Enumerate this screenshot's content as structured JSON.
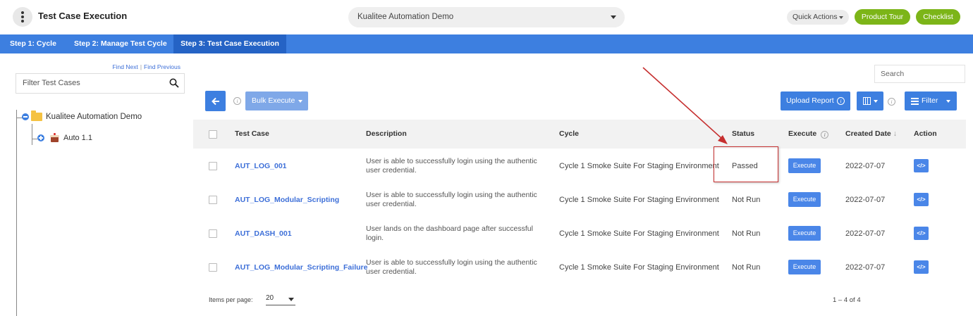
{
  "header": {
    "title": "Test Case Execution",
    "project": "Kualitee Automation Demo",
    "quick_actions": "Quick Actions",
    "product_tour": "Product Tour",
    "checklist": "Checklist"
  },
  "steps": [
    {
      "label": "Step 1: Cycle",
      "active": false
    },
    {
      "label": "Step 2: Manage Test Cycle",
      "active": false
    },
    {
      "label": "Step 3: Test Case Execution",
      "active": true
    }
  ],
  "left_panel": {
    "find_next": "Find Next",
    "separator": "|",
    "find_previous": "Find Previous",
    "filter_placeholder": "Filter Test Cases",
    "tree": {
      "root": "Kualitee Automation Demo",
      "child": "Auto 1.1"
    }
  },
  "toolbar": {
    "search_placeholder": "Search",
    "bulk_execute": "Bulk Execute",
    "upload_report": "Upload Report",
    "filter": "Filter"
  },
  "table": {
    "headers": {
      "test_case": "Test Case",
      "description": "Description",
      "cycle": "Cycle",
      "status": "Status",
      "execute": "Execute",
      "created_date": "Created Date",
      "action": "Action"
    },
    "rows": [
      {
        "test_case": "AUT_LOG_001",
        "description": "User is able to successfully login using the authentic user credential.",
        "cycle": "Cycle 1 Smoke Suite For Staging Environment",
        "status": "Passed",
        "execute": "Execute",
        "created_date": "2022-07-07",
        "action": "</>"
      },
      {
        "test_case": "AUT_LOG_Modular_Scripting",
        "description": "User is able to successfully login using the authentic user credential.",
        "cycle": "Cycle 1 Smoke Suite For Staging Environment",
        "status": "Not Run",
        "execute": "Execute",
        "created_date": "2022-07-07",
        "action": "</>"
      },
      {
        "test_case": "AUT_DASH_001",
        "description": "User lands on the dashboard page after successful login.",
        "cycle": "Cycle 1 Smoke Suite For Staging Environment",
        "status": "Not Run",
        "execute": "Execute",
        "created_date": "2022-07-07",
        "action": "</>"
      },
      {
        "test_case": "AUT_LOG_Modular_Scripting_Failure",
        "description": "User is able to successfully login using the authentic user credential.",
        "cycle": "Cycle 1 Smoke Suite For Staging Environment",
        "status": "Not Run",
        "execute": "Execute",
        "created_date": "2022-07-07",
        "action": "</>"
      }
    ]
  },
  "footer": {
    "items_per_page_label": "Items per page:",
    "items_per_page_value": "20",
    "range": "1 – 4 of 4"
  },
  "colors": {
    "primary_blue": "#3d7fe0",
    "active_step": "#2563c5",
    "green": "#7cb518",
    "annotation_red": "#c62f2f"
  }
}
